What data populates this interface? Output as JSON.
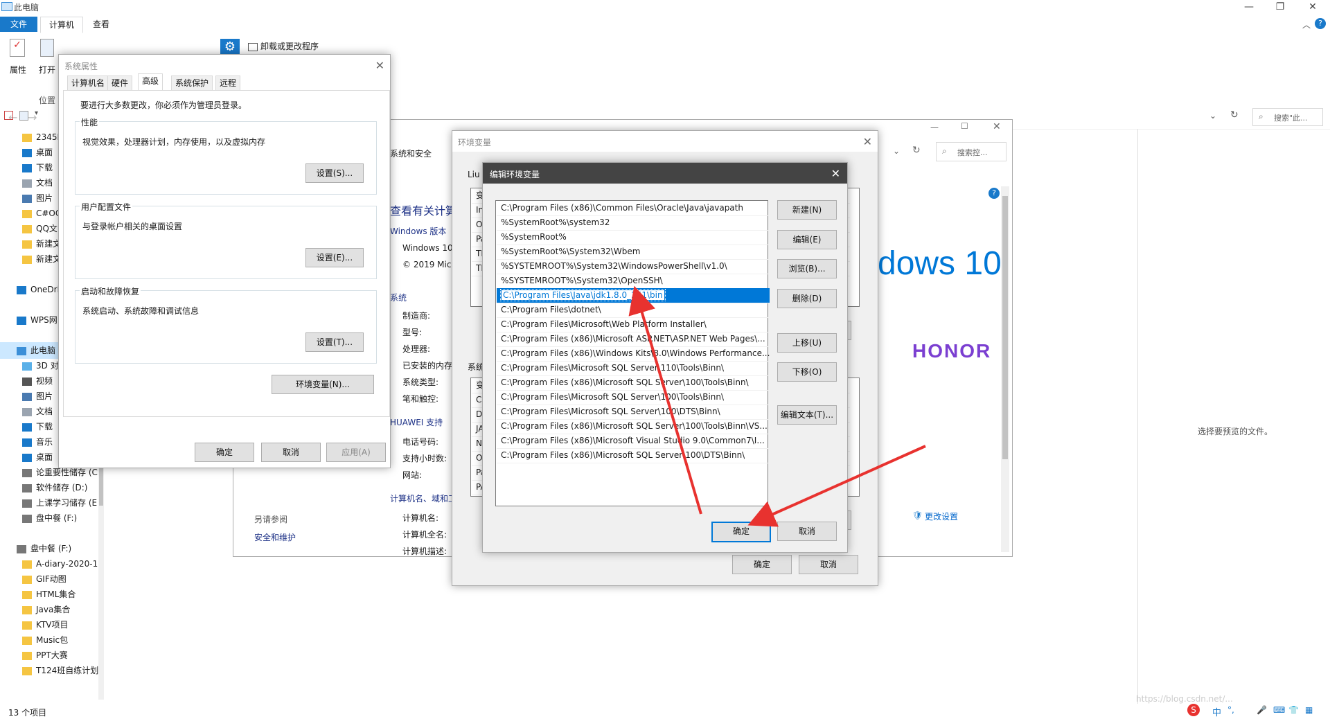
{
  "explorer": {
    "window_title": "此电脑",
    "menu": {
      "file": "文件",
      "tab_computer": "计算机",
      "tab_view": "查看"
    },
    "ribbon": {
      "properties": "属性",
      "open": "打开",
      "location": "位置",
      "uninstall": "卸载或更改程序"
    },
    "search_placeholder": "搜索\"此...",
    "preview_text": "选择要预览的文件。",
    "status": "13 个项目",
    "sidebar": [
      {
        "label": "2345D",
        "icon": "folder-icon",
        "level": 1
      },
      {
        "label": "桌面",
        "icon": "desktop-icon",
        "level": 1
      },
      {
        "label": "下载",
        "icon": "download-icon",
        "level": 1
      },
      {
        "label": "文档",
        "icon": "document-icon",
        "level": 1
      },
      {
        "label": "图片",
        "icon": "picture-icon",
        "level": 1
      },
      {
        "label": "C#OC",
        "icon": "folder-icon",
        "level": 1
      },
      {
        "label": "QQ文",
        "icon": "folder-icon",
        "level": 1
      },
      {
        "label": "新建文",
        "icon": "folder-icon",
        "level": 1
      },
      {
        "label": "新建文",
        "icon": "folder-icon",
        "level": 1
      },
      {
        "label": "",
        "icon": "",
        "level": 1
      },
      {
        "label": "OneDri",
        "icon": "cloud-icon",
        "level": 0
      },
      {
        "label": "",
        "icon": "",
        "level": 1
      },
      {
        "label": "WPS网",
        "icon": "cloud-icon",
        "level": 0
      },
      {
        "label": "",
        "icon": "",
        "level": 1
      },
      {
        "label": "此电脑",
        "icon": "computer-icon",
        "level": 0,
        "selected": true
      },
      {
        "label": "3D 对",
        "icon": "3d-icon",
        "level": 1
      },
      {
        "label": "视频",
        "icon": "video-icon",
        "level": 1
      },
      {
        "label": "图片",
        "icon": "picture-icon",
        "level": 1
      },
      {
        "label": "文档",
        "icon": "document-icon",
        "level": 1
      },
      {
        "label": "下载",
        "icon": "download-icon",
        "level": 1
      },
      {
        "label": "音乐",
        "icon": "music-icon",
        "level": 1
      },
      {
        "label": "桌面",
        "icon": "desktop-icon",
        "level": 1
      },
      {
        "label": "论重要性储存 (C",
        "icon": "drive-icon",
        "level": 1
      },
      {
        "label": "软件储存 (D:)",
        "icon": "drive-icon",
        "level": 1
      },
      {
        "label": "上课学习储存 (E",
        "icon": "drive-icon",
        "level": 1
      },
      {
        "label": "盘中餐 (F:)",
        "icon": "drive-icon",
        "level": 1
      },
      {
        "label": "",
        "icon": "",
        "level": 1
      },
      {
        "label": "盘中餐 (F:)",
        "icon": "drive-icon",
        "level": 0
      },
      {
        "label": "A-diary-2020-1",
        "icon": "folder-icon",
        "level": 1
      },
      {
        "label": "GIF动图",
        "icon": "folder-icon",
        "level": 1
      },
      {
        "label": "HTML集合",
        "icon": "folder-icon",
        "level": 1
      },
      {
        "label": "Java集合",
        "icon": "folder-icon",
        "level": 1
      },
      {
        "label": "KTV项目",
        "icon": "folder-icon",
        "level": 1
      },
      {
        "label": "Music包",
        "icon": "folder-icon",
        "level": 1
      },
      {
        "label": "PPT大赛",
        "icon": "folder-icon",
        "level": 1
      },
      {
        "label": "T124班自练计划",
        "icon": "folder-icon",
        "level": 1
      }
    ]
  },
  "system_info": {
    "breadcrumb": "系统和安全",
    "search_placeholder": "搜索控...",
    "heading": "查看有关计算",
    "windows_edition": "Windows 版本",
    "win10": "Windows 10",
    "copyright": "© 2019 Micr",
    "system": "系统",
    "maker": "制造商:",
    "model": "型号:",
    "processor": "处理器:",
    "ram": "已安装的内存",
    "sys_type": "系统类型:",
    "pen": "笔和触控:",
    "huawei_support": "HUAWEI 支持",
    "phone": "电话号码:",
    "hours": "支持小时数:",
    "website": "网站:",
    "computer_name_section": "计算机名、域和工",
    "computer_name": "计算机名:",
    "full_name": "计算机全名:",
    "desc": "计算机描述:",
    "see_also": "另请参阅",
    "security": "安全和维护",
    "change_settings": "更改设置",
    "logo_text": "dows 10",
    "brand": "HONOR"
  },
  "system_properties": {
    "title": "系统属性",
    "tabs": [
      "计算机名",
      "硬件",
      "高级",
      "系统保护",
      "远程"
    ],
    "admin_note": "要进行大多数更改，你必须作为管理员登录。",
    "perf_title": "性能",
    "perf_desc": "视觉效果，处理器计划，内存使用，以及虚拟内存",
    "perf_btn": "设置(S)...",
    "profile_title": "用户配置文件",
    "profile_desc": "与登录帐户相关的桌面设置",
    "profile_btn": "设置(E)...",
    "startup_title": "启动和故障恢复",
    "startup_desc": "系统启动、系统故障和调试信息",
    "startup_btn": "设置(T)...",
    "env_btn": "环境变量(N)...",
    "ok": "确定",
    "cancel": "取消",
    "apply": "应用(A)"
  },
  "env_vars": {
    "title": "环境变量",
    "user_label": "Liu",
    "system_label": "系统",
    "user_col": [
      "变",
      "In",
      "O",
      "Pa",
      "TE",
      "TN"
    ],
    "sys_col": [
      "变",
      "Co",
      "Dr",
      "JA",
      "N",
      "O",
      "Pa",
      "PA"
    ],
    "ok": "确定",
    "cancel": "取消"
  },
  "edit_env": {
    "title": "编辑环境变量",
    "entries": [
      "C:\\Program Files (x86)\\Common Files\\Oracle\\Java\\javapath",
      "%SystemRoot%\\system32",
      "%SystemRoot%",
      "%SystemRoot%\\System32\\Wbem",
      "%SYSTEMROOT%\\System32\\WindowsPowerShell\\v1.0\\",
      "%SYSTEMROOT%\\System32\\OpenSSH\\",
      "C:\\Program Files\\Java\\jdk1.8.0_251\\bin",
      "C:\\Program Files\\dotnet\\",
      "C:\\Program Files\\Microsoft\\Web Platform Installer\\",
      "C:\\Program Files (x86)\\Microsoft ASP.NET\\ASP.NET Web Pages\\...",
      "C:\\Program Files (x86)\\Windows Kits\\8.0\\Windows Performance...",
      "C:\\Program Files\\Microsoft SQL Server\\110\\Tools\\Binn\\",
      "C:\\Program Files (x86)\\Microsoft SQL Server\\100\\Tools\\Binn\\",
      "C:\\Program Files\\Microsoft SQL Server\\100\\Tools\\Binn\\",
      "C:\\Program Files\\Microsoft SQL Server\\100\\DTS\\Binn\\",
      "C:\\Program Files (x86)\\Microsoft SQL Server\\100\\Tools\\Binn\\VS...",
      "C:\\Program Files (x86)\\Microsoft Visual Studio 9.0\\Common7\\I...",
      "C:\\Program Files (x86)\\Microsoft SQL Server\\100\\DTS\\Binn\\"
    ],
    "selected_index": 6,
    "buttons": {
      "new": "新建(N)",
      "edit": "编辑(E)",
      "browse": "浏览(B)...",
      "delete": "删除(D)",
      "up": "上移(U)",
      "down": "下移(O)",
      "edit_text": "编辑文本(T)...",
      "ok": "确定",
      "cancel": "取消"
    }
  },
  "watermark": "https://blog.csdn.net/...",
  "tray": {
    "ime": "中",
    "punct": "°,"
  },
  "colors": {
    "accent": "#0078d7",
    "arrow": "#e8322f",
    "honor": "#7b3fd1"
  }
}
